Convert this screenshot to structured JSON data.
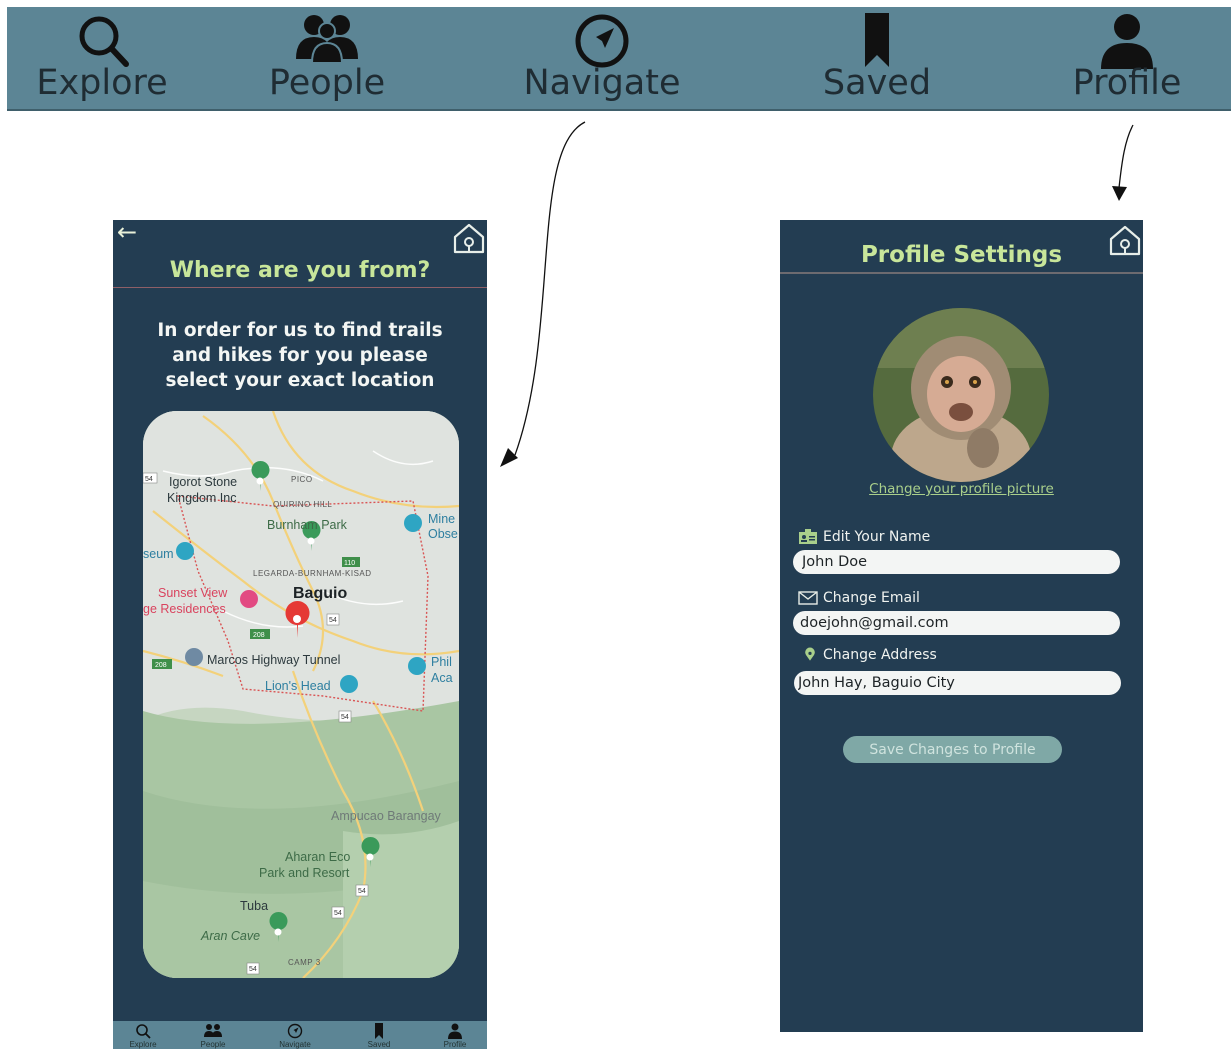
{
  "top_nav": {
    "items": [
      {
        "label": "Explore",
        "icon": "search-icon"
      },
      {
        "label": "People",
        "icon": "people-icon"
      },
      {
        "label": "Navigate",
        "icon": "navigate-icon"
      },
      {
        "label": "Saved",
        "icon": "bookmark-icon"
      },
      {
        "label": "Profile",
        "icon": "person-icon"
      }
    ]
  },
  "location_screen": {
    "back": "←",
    "title": "Where are you from?",
    "intro": "In order for us to find trails and hikes for you please select your exact location",
    "map": {
      "city": "Baguio",
      "labels": {
        "igorot": "Igorot Stone",
        "kingdom": "Kingdom Inc",
        "pico": "PICO",
        "quirino": "QUIRINO HILL",
        "burnham": "Burnham Park",
        "museum": "seum",
        "mines": "Mine",
        "obse": "Obse",
        "legarda": "LEGARDA-BURNHAM-KISAD",
        "sunset": "Sunset View",
        "residences": "ge Residences",
        "marcos": "Marcos Highway Tunnel",
        "lions": "Lion's Head",
        "phil": "Phil",
        "aca": "Aca",
        "ampucao": "Ampucao Barangay",
        "aharan1": "Aharan Eco",
        "aharan2": "Park and Resort",
        "tuba": "Tuba",
        "aran": "Aran Cave",
        "camp": "CAMP 3"
      },
      "road_badges": [
        "54",
        "110",
        "208",
        "208",
        "54",
        "54",
        "54",
        "54",
        "54"
      ]
    },
    "bottom_nav": [
      "Explore",
      "People",
      "Navigate",
      "Saved",
      "Profile"
    ]
  },
  "profile_screen": {
    "title": "Profile Settings",
    "change_picture": "Change your profile picture",
    "fields": [
      {
        "label": "Edit Your Name",
        "value": "John Doe",
        "icon": "id-card-icon"
      },
      {
        "label": "Change Email",
        "value": "doejohn@gmail.com",
        "icon": "mail-icon"
      },
      {
        "label": "Change Address",
        "value": "John Hay, Baguio City",
        "icon": "location-pin-icon"
      }
    ],
    "save_button": "Save Changes to Profile"
  },
  "colors": {
    "nav_bar": "#5c8595",
    "screen_bg": "#233d52",
    "accent_green": "#c8e69a",
    "button": "#7fa8a6"
  }
}
